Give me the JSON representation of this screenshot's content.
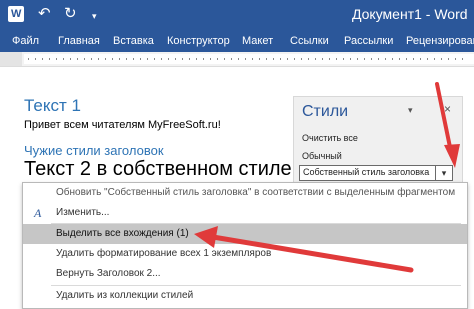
{
  "titlebar": {
    "icon": "word-icon",
    "title": "Документ1  -  Word",
    "undo_icon": "undo-icon",
    "redo_icon": "redo-icon",
    "save_icon": "save-icon"
  },
  "ribbon": {
    "tabs": [
      "Файл",
      "Главная",
      "Вставка",
      "Конструктор",
      "Макет",
      "Ссылки",
      "Рассылки",
      "Рецензировани"
    ]
  },
  "document": {
    "heading1": "Текст 1",
    "line1": "Привет всем читателям MyFreeSoft.ru!",
    "heading2": "Чужие стили заголовок",
    "heading3": "Текст 2 в собственном стиле"
  },
  "styles_pane": {
    "title": "Стили",
    "items": [
      "Очистить все",
      "Обычный",
      "Собственный стиль заголовка"
    ]
  },
  "context_menu": {
    "items": [
      "Обновить \"Собственный стиль заголовка\" в соответствии с выделенным фрагментом",
      "Изменить...",
      "Выделить все вхождения (1)",
      "Удалить форматирование всех 1 экземпляров",
      "Вернуть Заголовок 2...",
      "Удалить из коллекции стилей"
    ],
    "highlighted_index": 2
  },
  "colors": {
    "accent": "#2b579a",
    "heading": "#2e74b5",
    "arrow": "#e03a3a",
    "highlight": "#c6c6c6"
  }
}
